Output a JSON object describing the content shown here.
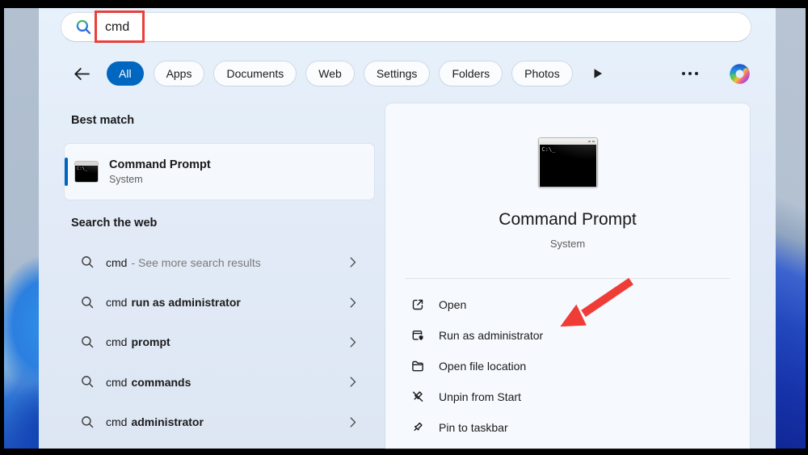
{
  "search": {
    "value": "cmd"
  },
  "tabs": {
    "items": [
      "All",
      "Apps",
      "Documents",
      "Web",
      "Settings",
      "Folders",
      "Photos"
    ],
    "selected": "All"
  },
  "left_pane": {
    "best_match_heading": "Best match",
    "best_match_item": {
      "title": "Command Prompt",
      "subtitle": "System"
    },
    "web_heading": "Search the web",
    "suggestions": [
      {
        "query": "cmd",
        "suffix": "- See more search results"
      },
      {
        "query": "cmd",
        "completion": "run as administrator"
      },
      {
        "query": "cmd",
        "completion": "prompt"
      },
      {
        "query": "cmd",
        "completion": "commands"
      },
      {
        "query": "cmd",
        "completion": "administrator"
      }
    ]
  },
  "preview_pane": {
    "title": "Command Prompt",
    "subtitle": "System",
    "actions": [
      {
        "icon": "open-icon",
        "label": "Open"
      },
      {
        "icon": "run-as-administrator-icon",
        "label": "Run as administrator"
      },
      {
        "icon": "open-file-location-icon",
        "label": "Open file location"
      },
      {
        "icon": "unpin-from-start-icon",
        "label": "Unpin from Start"
      },
      {
        "icon": "pin-to-taskbar-icon",
        "label": "Pin to taskbar"
      }
    ]
  },
  "icons": {
    "cmd_glyph": "C:\\_"
  },
  "colors": {
    "accent": "#0067c0",
    "annotation_red": "#e8403a"
  },
  "annotations": {
    "highlight_box_on": "search query",
    "arrow_points_to": "Run as administrator"
  }
}
